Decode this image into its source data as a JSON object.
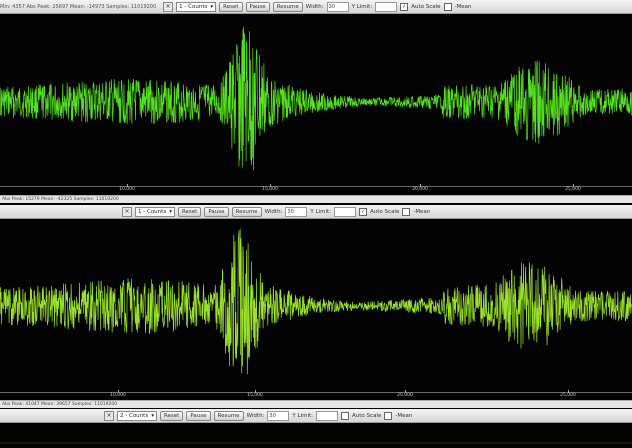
{
  "panels": [
    {
      "stats": "Min: 4357  Abs Peak: 25697  Mean: -14973  Samples: 11019200",
      "channel_select": "1 - Counts",
      "buttons": [
        "Reset",
        "Pause",
        "Resume"
      ],
      "width_label": "Width:",
      "width_value": "30",
      "ylimit_label": "Y Limit:",
      "ylimit_value": "",
      "autoscale_label": "Auto Scale",
      "autoscale_checked": true,
      "mean_label": "-Mean",
      "mean_checked": false,
      "axis_ticks": [
        "10,000",
        "15,000",
        "20,000",
        "25,000"
      ],
      "waveform": {
        "color": "#56e01f",
        "baseline": 0.5,
        "event_position": 0.39,
        "event_amplitude": 0.95,
        "noise_amplitude": 0.32,
        "tail_position": 0.85,
        "tail_amplitude": 0.5
      }
    },
    {
      "stats": "Abs Peak: 15279  Mean: -42325  Samples: 11019200",
      "channel_select": "1 - Counts",
      "buttons": [
        "Reset",
        "Pause",
        "Resume"
      ],
      "width_label": "Width:",
      "width_value": "30",
      "ylimit_label": "Y Limit:",
      "ylimit_value": "",
      "autoscale_label": "Auto Scale",
      "autoscale_checked": true,
      "mean_label": "-Mean",
      "mean_checked": false,
      "axis_ticks": [
        "10,000",
        "15,000",
        "20,000",
        "25,000"
      ],
      "waveform": {
        "color": "#9be02a",
        "baseline": 0.5,
        "event_position": 0.38,
        "event_amplitude": 0.92,
        "noise_amplitude": 0.38,
        "tail_position": 0.84,
        "tail_amplitude": 0.55
      }
    },
    {
      "stats": "Abs Peak: 41047  Mean: 39657  Samples: 11019200",
      "channel_select": "2 - Counts",
      "buttons": [
        "Reset",
        "Pause",
        "Resume"
      ],
      "width_label": "Width:",
      "width_value": "30",
      "ylimit_label": "Y Limit:",
      "ylimit_value": "",
      "autoscale_label": "Auto Scale",
      "autoscale_checked": false,
      "mean_label": "-Mean",
      "mean_checked": false
    }
  ]
}
